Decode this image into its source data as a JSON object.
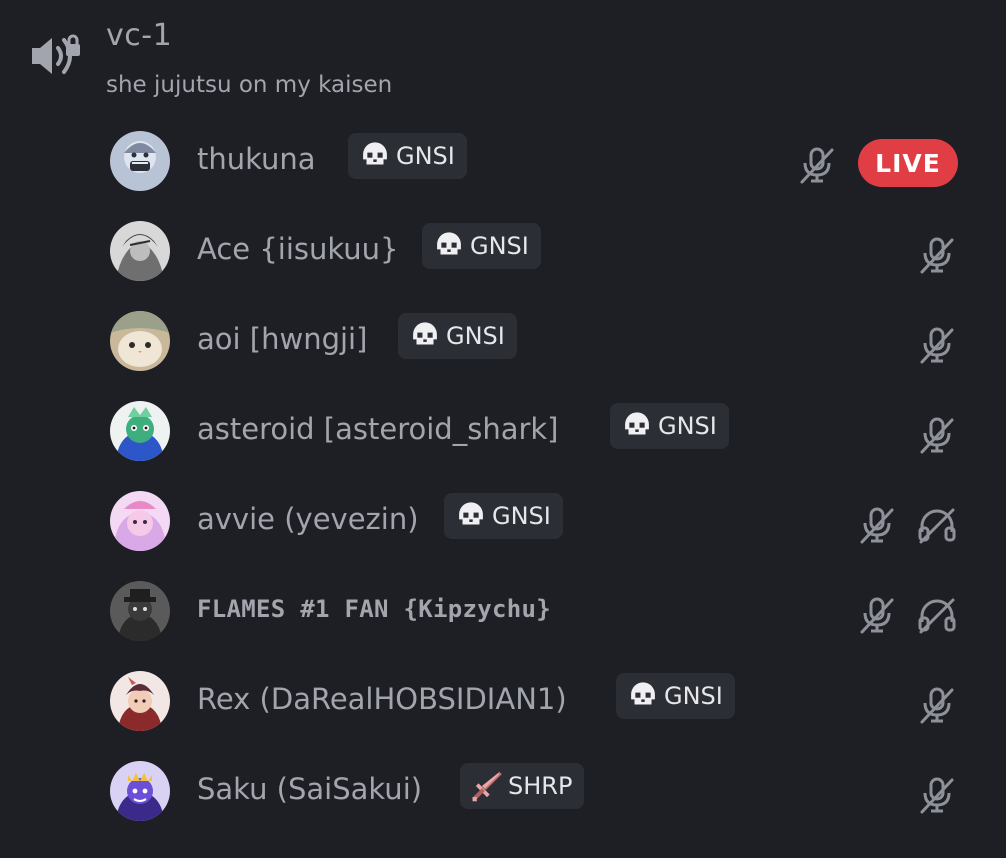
{
  "channel": {
    "name": "vc-1",
    "status": "she jujutsu on my kaisen",
    "icon": "speaker-locked-icon"
  },
  "users": [
    {
      "name": "thukuna",
      "tag": {
        "label": "GNSI",
        "icon": "skull-icon"
      },
      "muted": true,
      "deafened": false,
      "live": true,
      "live_label": "LIVE",
      "avatar_color": "#b9c3d6"
    },
    {
      "name": "Ace {iisukuu}",
      "tag": {
        "label": "GNSI",
        "icon": "skull-icon"
      },
      "muted": true,
      "deafened": false,
      "live": false,
      "avatar_color": "#9a9a9a"
    },
    {
      "name": "aoi [hwngji]",
      "tag": {
        "label": "GNSI",
        "icon": "skull-icon"
      },
      "muted": true,
      "deafened": false,
      "live": false,
      "avatar_color": "#c9b89a"
    },
    {
      "name": "asteroid [asteroid_shark]",
      "tag": {
        "label": "GNSI",
        "icon": "skull-icon"
      },
      "muted": true,
      "deafened": false,
      "live": false,
      "avatar_color": "#3fae7e"
    },
    {
      "name": "avvie (yevezin)",
      "tag": {
        "label": "GNSI",
        "icon": "skull-icon"
      },
      "muted": true,
      "deafened": true,
      "live": false,
      "avatar_color": "#d9a8e6"
    },
    {
      "name": "FLAMES #1 FAN {Kipzychu}",
      "tag": null,
      "muted": true,
      "deafened": true,
      "live": false,
      "avatar_color": "#3a3a3a",
      "pixel_font": true
    },
    {
      "name": "Rex (DaRealHOBSIDIAN1)",
      "tag": {
        "label": "GNSI",
        "icon": "skull-icon"
      },
      "muted": true,
      "deafened": false,
      "live": false,
      "avatar_color": "#c25a5a"
    },
    {
      "name": "Saku (SaiSakui)",
      "tag": {
        "label": "SHRP",
        "icon": "sword-icon"
      },
      "muted": true,
      "deafened": false,
      "live": false,
      "avatar_color": "#6b4fd6"
    }
  ],
  "colors": {
    "background": "#1e1f24",
    "text_muted": "#a2a5ad",
    "tag_bg": "#2c2e35",
    "live_red": "#e03e44"
  }
}
